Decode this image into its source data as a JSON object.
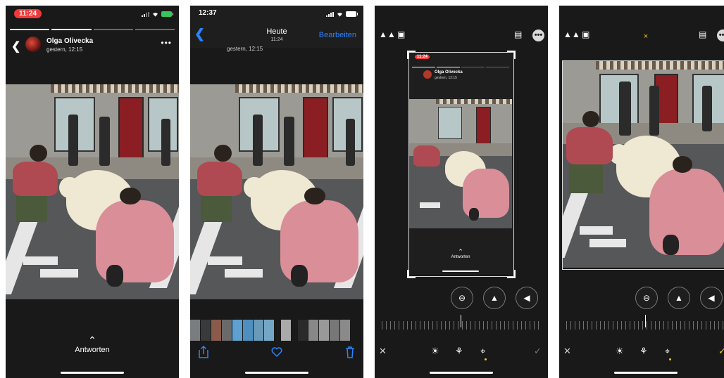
{
  "panel1": {
    "status_time": "11:24",
    "user_name": "Olga Olivecka",
    "post_time": "gestern, 12:15",
    "reply_label": "Antworten",
    "more_label": "•••"
  },
  "panel2": {
    "status_time": "12:37",
    "nav_title": "Heute",
    "nav_subtitle": "11:24",
    "nav_edit": "Bearbeiten",
    "ghost_text": "gestern, 12:15"
  },
  "panel3": {
    "mini_time": "11:24",
    "mini_user": "Olga Olivecka",
    "mini_date": "gestern, 12:15",
    "mini_reply": "Antworten"
  },
  "panel4": {
    "cancel_label": "×"
  },
  "colors": {
    "ios_blue": "#2a84ff",
    "status_red": "#f03a3a",
    "edit_yellow": "#f5c518"
  },
  "icons": {
    "back": "chevron-left-icon",
    "share": "share-icon",
    "heart": "heart-icon",
    "trash": "trash-icon",
    "flip": "flip-horizontal-icon",
    "rotate": "rotate-icon",
    "aspect": "aspect-ratio-icon",
    "more": "more-icon",
    "auto": "auto-enhance-icon",
    "filters": "filters-icon",
    "crop": "crop-icon"
  }
}
